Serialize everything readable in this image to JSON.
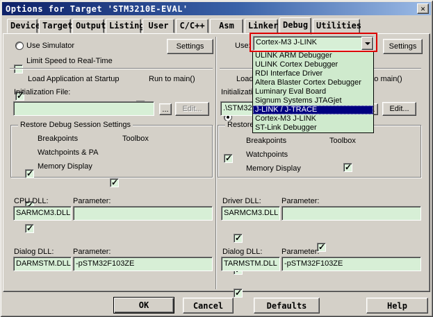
{
  "window": {
    "title": "Options for Target 'STM3210E-EVAL'"
  },
  "icons": {
    "close": "✕"
  },
  "tabs": [
    "Device",
    "Target",
    "Output",
    "Listing",
    "User",
    "C/C++",
    "Asm",
    "Linker",
    "Debug",
    "Utilities"
  ],
  "left": {
    "use_simulator": "Use Simulator",
    "settings": "Settings",
    "limit_speed": "Limit Speed to Real-Time",
    "load_app": "Load Application at Startup",
    "run_main": "Run to main()",
    "init_label": "Initialization File:",
    "init_value": "",
    "browse": "...",
    "edit": "Edit...",
    "restore": {
      "title": "Restore Debug Session Settings",
      "breakpoints": "Breakpoints",
      "toolbox": "Toolbox",
      "watchpoints": "Watchpoints & PA",
      "memory": "Memory Display"
    },
    "cpu_label": "CPU DLL:",
    "cpu_value": "SARMCM3.DLL",
    "cpu_param_label": "Parameter:",
    "cpu_param_value": "",
    "dlg_label": "Dialog DLL:",
    "dlg_value": "DARMSTM.DLL",
    "dlg_param_label": "Parameter:",
    "dlg_param_value": "-pSTM32F103ZE"
  },
  "right": {
    "use_label": "Use:",
    "driver_selected": "Cortex-M3 J-LINK",
    "settings": "Settings",
    "load_app": "Load Application at Startup",
    "run_main": "Run to main()",
    "init_label": "Initialization File:",
    "init_value": ".\\STM32",
    "browse": "...",
    "edit": "Edit...",
    "restore": {
      "title": "Restore Debug Session Settings",
      "breakpoints": "Breakpoints",
      "toolbox": "Toolbox",
      "watchpoints": "Watchpoints",
      "memory": "Memory Display"
    },
    "driver_label": "Driver DLL:",
    "driver_value": "SARMCM3.DLL",
    "driver_param_label": "Parameter:",
    "driver_param_value": "",
    "dlg_label": "Dialog DLL:",
    "dlg_value": "TARMSTM.DLL",
    "dlg_param_label": "Parameter:",
    "dlg_param_value": "-pSTM32F103ZE"
  },
  "dropdown": {
    "items": [
      "ULINK ARM Debugger",
      "ULINK Cortex Debugger",
      "RDI Interface Driver",
      "Altera Blaster Cortex Debugger",
      "Luminary Eval Board",
      "Signum Systems JTAGjet",
      "J-LINK / J-TRACE",
      "Cortex-M3 J-LINK",
      "ST-Link Debugger"
    ],
    "selected": "J-LINK / J-TRACE",
    "selected_index": 6
  },
  "footer": {
    "ok": "OK",
    "cancel": "Cancel",
    "defaults": "Defaults",
    "help": "Help"
  },
  "colors": {
    "dialog_gray": "#d4d0c8",
    "field_green": "#d7efd6",
    "list_green": "#cfeacd",
    "selection_navy": "#000080",
    "annotation_red": "#dd0000",
    "titlebar_left": "#0e2168",
    "titlebar_right": "#9cbbe6"
  }
}
